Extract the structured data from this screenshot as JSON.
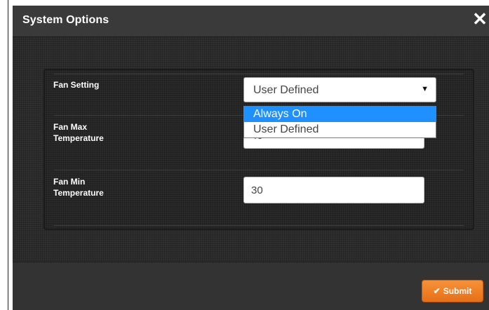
{
  "dialog": {
    "title": "System Options",
    "close_glyph": "✕"
  },
  "form": {
    "fan_setting": {
      "label": "Fan Setting",
      "selected_value": "User Defined",
      "options": [
        "Always On",
        "User Defined"
      ],
      "highlighted_option": "Always On"
    },
    "fan_max_temperature": {
      "label_line1": "Fan Max",
      "label_line2": "Temperature",
      "value": "40"
    },
    "fan_min_temperature": {
      "label_line1": "Fan Min",
      "label_line2": "Temperature",
      "value": "30"
    }
  },
  "footer": {
    "submit_label": "Submit",
    "submit_icon": "check-icon"
  },
  "colors": {
    "dialog_bg": "#2b2b2b",
    "header_bg": "#3a3a3a",
    "submit_bg": "#ee7b20",
    "dropdown_highlight": "#1e90ff"
  }
}
